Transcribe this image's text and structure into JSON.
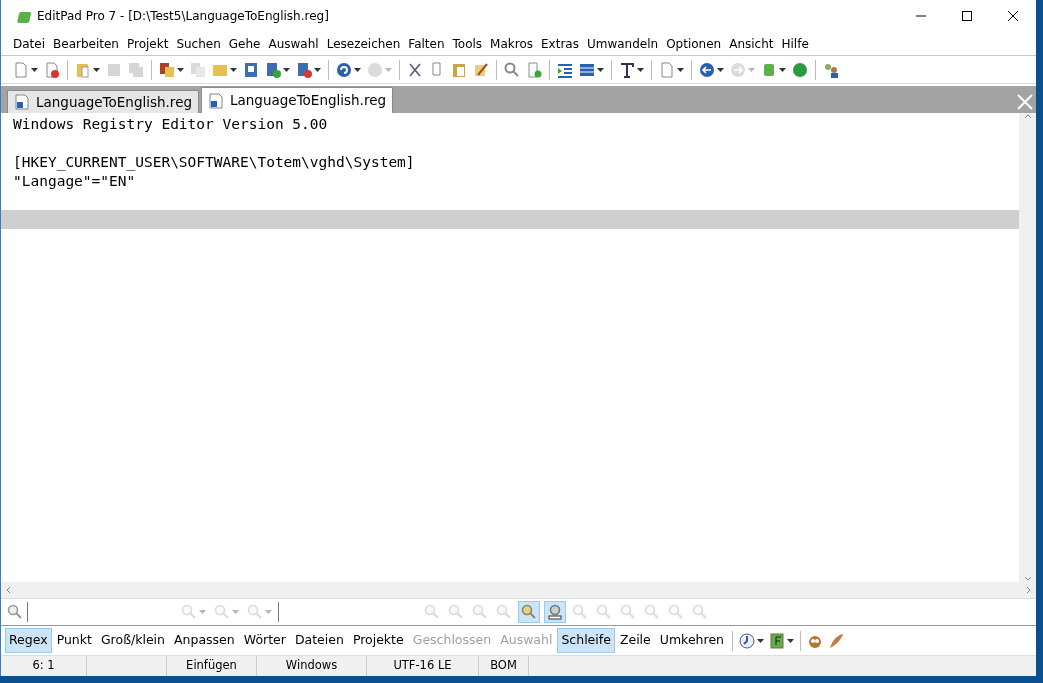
{
  "window": {
    "title": "EditPad Pro 7 - [D:\\Test5\\LanguageToEnglish.reg]"
  },
  "menu": [
    "Datei",
    "Bearbeiten",
    "Projekt",
    "Suchen",
    "Gehe",
    "Auswahl",
    "Lesezeichen",
    "Falten",
    "Tools",
    "Makros",
    "Extras",
    "Umwandeln",
    "Optionen",
    "Ansicht",
    "Hilfe"
  ],
  "toolbar": [
    {
      "kind": "button",
      "disabled": false,
      "dropdown": true
    },
    {
      "kind": "button",
      "disabled": false,
      "dropdown": false
    },
    {
      "kind": "separator"
    },
    {
      "kind": "button",
      "disabled": false,
      "dropdown": true
    },
    {
      "kind": "button",
      "disabled": true,
      "dropdown": false
    },
    {
      "kind": "button",
      "disabled": true,
      "dropdown": false
    },
    {
      "kind": "separator"
    },
    {
      "kind": "button",
      "disabled": false,
      "dropdown": true
    },
    {
      "kind": "button",
      "disabled": true,
      "dropdown": false
    },
    {
      "kind": "button",
      "disabled": false,
      "dropdown": true
    },
    {
      "kind": "button",
      "disabled": false,
      "dropdown": false
    },
    {
      "kind": "button",
      "disabled": false,
      "dropdown": true
    },
    {
      "kind": "button",
      "disabled": false,
      "dropdown": true
    },
    {
      "kind": "separator"
    },
    {
      "kind": "button",
      "disabled": false,
      "dropdown": true
    },
    {
      "kind": "button",
      "disabled": true,
      "dropdown": true
    },
    {
      "kind": "separator"
    },
    {
      "kind": "button",
      "disabled": false,
      "dropdown": false
    },
    {
      "kind": "button",
      "disabled": false,
      "dropdown": false
    },
    {
      "kind": "button",
      "disabled": false,
      "dropdown": false
    },
    {
      "kind": "button",
      "disabled": false,
      "dropdown": false
    },
    {
      "kind": "separator"
    },
    {
      "kind": "button",
      "disabled": false,
      "dropdown": false
    },
    {
      "kind": "button",
      "disabled": false,
      "dropdown": false
    },
    {
      "kind": "separator"
    },
    {
      "kind": "button",
      "disabled": false,
      "dropdown": false
    },
    {
      "kind": "button",
      "disabled": false,
      "dropdown": true
    },
    {
      "kind": "separator"
    },
    {
      "kind": "button",
      "disabled": false,
      "dropdown": true
    },
    {
      "kind": "separator"
    },
    {
      "kind": "button",
      "disabled": false,
      "dropdown": true
    },
    {
      "kind": "separator"
    },
    {
      "kind": "button",
      "disabled": false,
      "dropdown": true
    },
    {
      "kind": "button",
      "disabled": true,
      "dropdown": true
    },
    {
      "kind": "button",
      "disabled": false,
      "dropdown": true
    },
    {
      "kind": "button",
      "disabled": false,
      "dropdown": false
    },
    {
      "kind": "separator"
    },
    {
      "kind": "button",
      "disabled": false,
      "dropdown": false
    }
  ],
  "tabs": [
    {
      "label": "LanguageToEnglish.reg",
      "selected": false
    },
    {
      "label": "LanguageToEnglish.reg",
      "selected": true
    }
  ],
  "editor": {
    "lines": [
      {
        "kind": "text",
        "text": "Windows Registry Editor Version 5.00",
        "current": false
      },
      {
        "kind": "blank"
      },
      {
        "kind": "text",
        "text": "[HKEY_CURRENT_USER\\SOFTWARE\\Totem\\vghd\\System]",
        "current": false
      },
      {
        "kind": "text",
        "text": "\"Langage\"=\"EN\"",
        "current": false
      },
      {
        "kind": "blank"
      },
      {
        "kind": "blank",
        "current": true
      }
    ]
  },
  "search_options": [
    {
      "label": "Regex",
      "selected": true,
      "disabled": false
    },
    {
      "label": "Punkt",
      "selected": false,
      "disabled": false
    },
    {
      "label": "Groß/klein",
      "selected": false,
      "disabled": false
    },
    {
      "label": "Anpassen",
      "selected": false,
      "disabled": false
    },
    {
      "label": "Wörter",
      "selected": false,
      "disabled": false
    },
    {
      "label": "Dateien",
      "selected": false,
      "disabled": false
    },
    {
      "label": "Projekte",
      "selected": false,
      "disabled": false
    },
    {
      "label": "Geschlossen",
      "selected": false,
      "disabled": true
    },
    {
      "label": "Auswahl",
      "selected": false,
      "disabled": true
    },
    {
      "label": "Schleife",
      "selected": true,
      "disabled": false
    },
    {
      "label": "Zeile",
      "selected": false,
      "disabled": false
    },
    {
      "label": "Umkehren",
      "selected": false,
      "disabled": false
    }
  ],
  "status_bar": [
    "6: 1",
    "Einfügen",
    "Windows",
    "UTF-16 LE",
    "BOM"
  ]
}
